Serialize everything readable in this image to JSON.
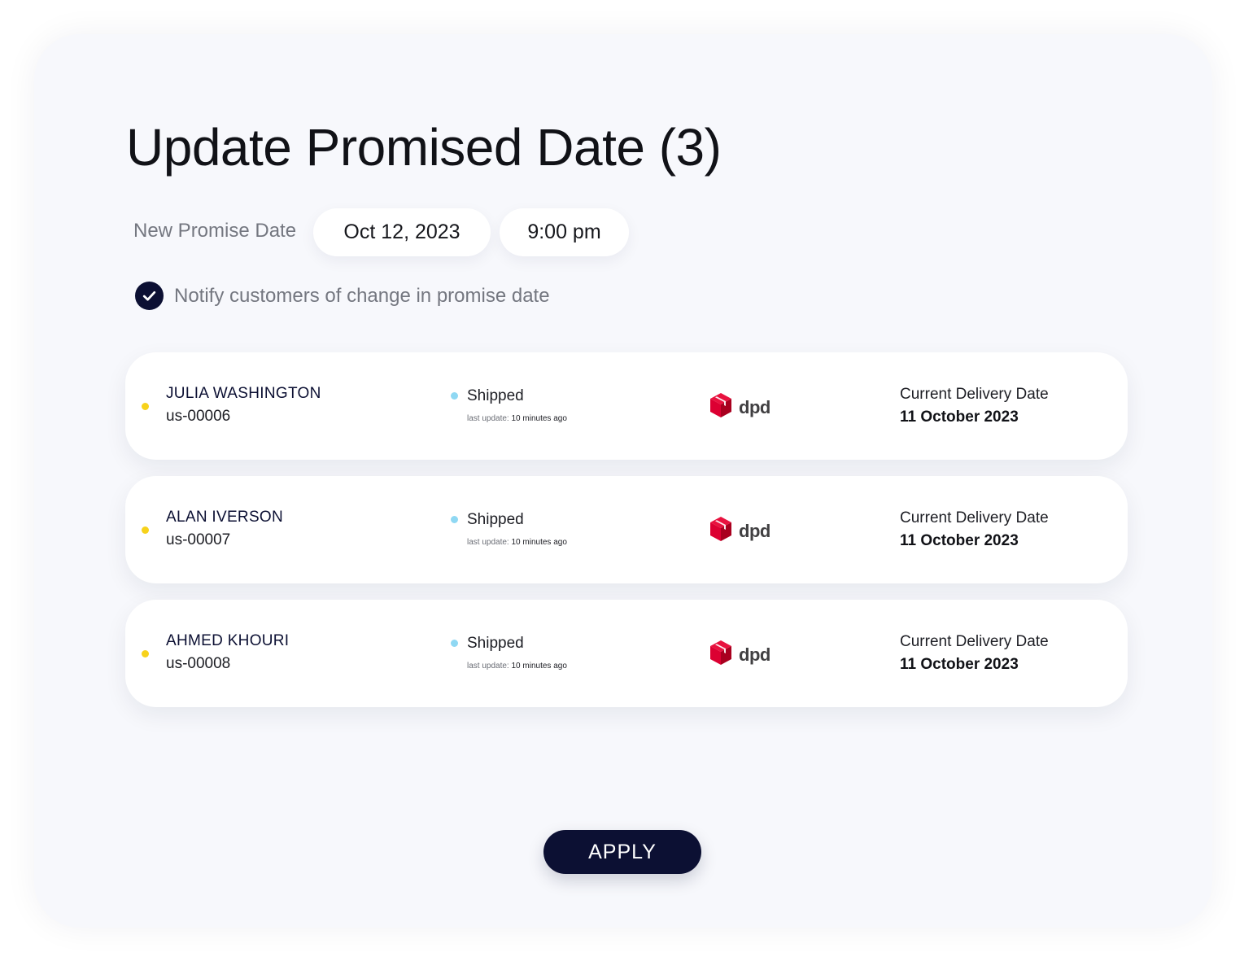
{
  "dialog": {
    "title": "Update Promised Date (3)",
    "new_promise_label": "New Promise Date",
    "date_value": "Oct 12, 2023",
    "time_value": "9:00 pm",
    "notify_label": "Notify customers of change in promise date",
    "notify_checked": true,
    "apply_label": "APPLY"
  },
  "orders": [
    {
      "name": "JULIA WASHINGTON",
      "id": "us-00006",
      "status": "Shipped",
      "last_update_label": "last update:",
      "last_update_value": "10 minutes ago",
      "carrier": "dpd",
      "current_delivery_label": "Current Delivery Date",
      "current_delivery_date": "11 October 2023"
    },
    {
      "name": "ALAN IVERSON",
      "id": "us-00007",
      "status": "Shipped",
      "last_update_label": "last update:",
      "last_update_value": "10 minutes ago",
      "carrier": "dpd",
      "current_delivery_label": "Current Delivery Date",
      "current_delivery_date": "11 October 2023"
    },
    {
      "name": "AHMED KHOURI",
      "id": "us-00008",
      "status": "Shipped",
      "last_update_label": "last update:",
      "last_update_value": "10 minutes ago",
      "carrier": "dpd",
      "current_delivery_label": "Current Delivery Date",
      "current_delivery_date": "11 October 2023"
    }
  ],
  "icons": {
    "checkbox": "checkmark-circle-icon",
    "priority_dot": "yellow-dot-icon",
    "status_dot": "light-blue-dot-icon",
    "carrier_logo": "dpd-cube-icon"
  },
  "colors": {
    "primary_navy": "#0c1033",
    "priority_yellow": "#f7d21b",
    "status_blue": "#8fd8f3",
    "dpd_red": "#dc0032",
    "card_background": "#f7f8fc"
  }
}
